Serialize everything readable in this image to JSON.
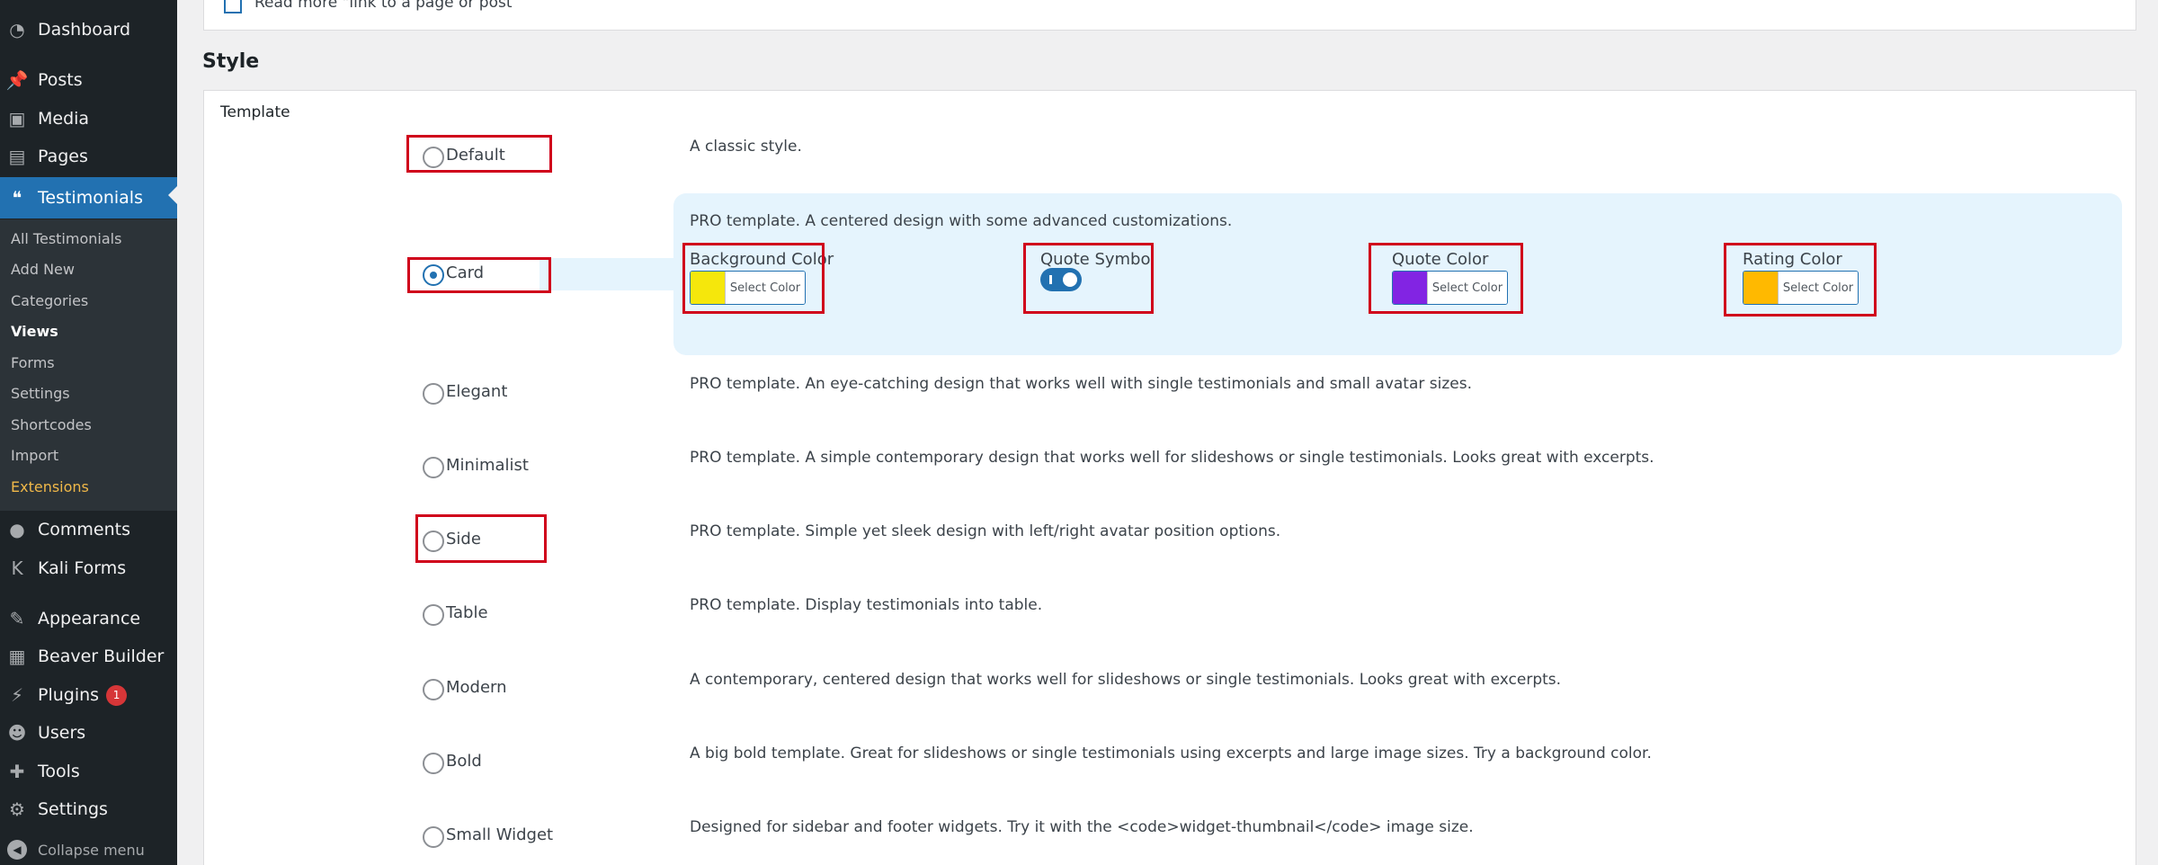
{
  "sidebar": {
    "items": [
      {
        "label": "Dashboard",
        "icon": "dashboard-icon",
        "glyph": "◔"
      },
      {
        "label": "Posts",
        "icon": "pin-icon",
        "glyph": "📌"
      },
      {
        "label": "Media",
        "icon": "media-icon",
        "glyph": "▣"
      },
      {
        "label": "Pages",
        "icon": "pages-icon",
        "glyph": "▤"
      },
      {
        "label": "Testimonials",
        "icon": "quote-icon",
        "glyph": "❝"
      },
      {
        "label": "Comments",
        "icon": "comment-icon",
        "glyph": "●"
      },
      {
        "label": "Kali Forms",
        "icon": "kali-forms-icon",
        "glyph": "K"
      },
      {
        "label": "Appearance",
        "icon": "paintbrush-icon",
        "glyph": "✎"
      },
      {
        "label": "Beaver Builder",
        "icon": "layout-icon",
        "glyph": "▦"
      },
      {
        "label": "Plugins",
        "icon": "plug-icon",
        "glyph": "⚡",
        "badge": "1"
      },
      {
        "label": "Users",
        "icon": "user-icon",
        "glyph": "☻"
      },
      {
        "label": "Tools",
        "icon": "wrench-icon",
        "glyph": "✚"
      },
      {
        "label": "Settings",
        "icon": "settings-icon",
        "glyph": "⚙"
      }
    ],
    "submenu": [
      "All Testimonials",
      "Add New",
      "Categories",
      "Views",
      "Forms",
      "Settings",
      "Shortcodes",
      "Import",
      "Extensions"
    ],
    "collapse_label": "Collapse menu"
  },
  "top_option": {
    "label": "Read more \"link to a page or post"
  },
  "section_heading": "Style",
  "template_label": "Template",
  "templates": [
    {
      "name": "Default",
      "description": "A classic style.",
      "checked": false
    },
    {
      "name": "Card",
      "description": "PRO template. A centered design with some advanced customizations.",
      "checked": true
    },
    {
      "name": "Elegant",
      "description": "PRO template. An eye-catching design that works well with single testimonials and small avatar sizes.",
      "checked": false
    },
    {
      "name": "Minimalist",
      "description": "PRO template. A simple contemporary design that works well for slideshows or single testimonials. Looks great with excerpts.",
      "checked": false
    },
    {
      "name": "Side",
      "description": "PRO template. Simple yet sleek design with left/right avatar position options.",
      "checked": false
    },
    {
      "name": "Table",
      "description": "PRO template. Display testimonials into table.",
      "checked": false
    },
    {
      "name": "Modern",
      "description": "A contemporary, centered design that works well for slideshows or single testimonials. Looks great with excerpts.",
      "checked": false
    },
    {
      "name": "Bold",
      "description": "A big bold template. Great for slideshows or single testimonials using excerpts and large image sizes. Try a background color.",
      "checked": false
    },
    {
      "name": "Small Widget",
      "description": "Designed for sidebar and footer widgets. Try it with the <code>widget-thumbnail</code> image size.",
      "checked": false
    }
  ],
  "card_options": {
    "background_color": {
      "label": "Background Color",
      "color": "#f5e70c",
      "button": "Select Color"
    },
    "quote_symbol": {
      "label": "Quote Symbol",
      "enabled": true
    },
    "quote_color": {
      "label": "Quote Color",
      "color": "#8224e3",
      "button": "Select Color"
    },
    "rating_color": {
      "label": "Rating Color",
      "color": "#ffb900",
      "button": "Select Color"
    }
  },
  "colors": {
    "sidebar_bg": "#1d2327",
    "accent": "#2271b1",
    "highlight_red": "#d0021b",
    "card_bg": "#e5f4fd"
  }
}
